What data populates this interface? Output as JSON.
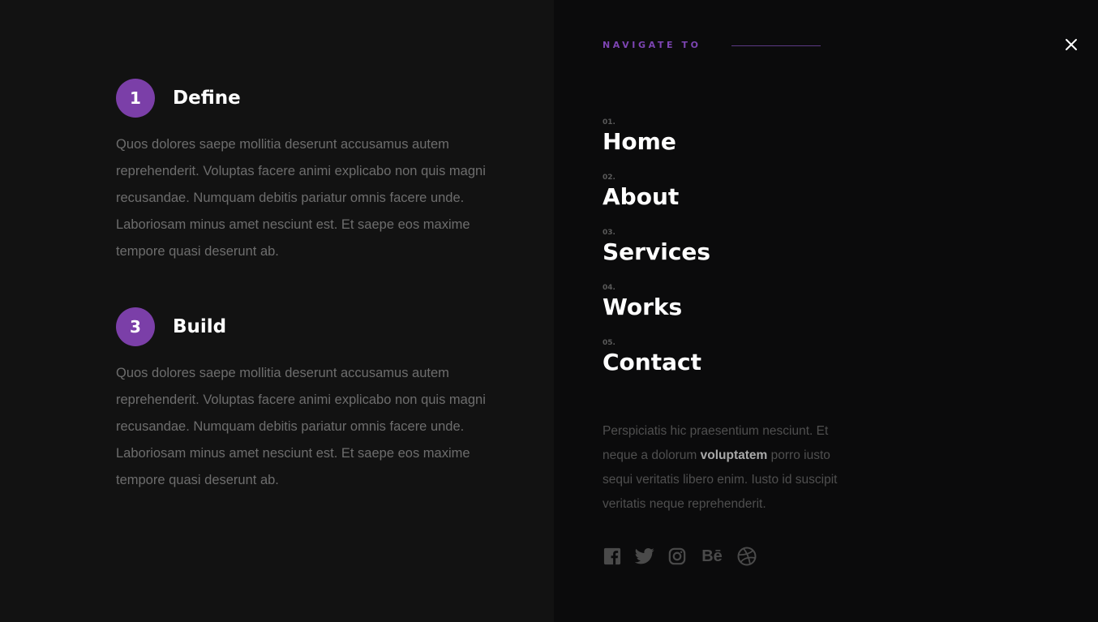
{
  "steps": [
    {
      "number": "1",
      "title": "Define",
      "text": "Quos dolores saepe mollitia deserunt accusamus autem reprehenderit. Voluptas facere animi explicabo non quis magni recusandae. Numquam debitis pariatur omnis facere unde. Laboriosam minus amet nesciunt est. Et saepe eos maxime tempore quasi deserunt ab."
    },
    {
      "number": "3",
      "title": "Build",
      "text": "Quos dolores saepe mollitia deserunt accusamus autem reprehenderit. Voluptas facere animi explicabo non quis magni recusandae. Numquam debitis pariatur omnis facere unde. Laboriosam minus amet nesciunt est. Et saepe eos maxime tempore quasi deserunt ab."
    }
  ],
  "nav": {
    "label": "NAVIGATE TO",
    "close_icon": "close-icon",
    "items": [
      {
        "num": "01.",
        "label": "Home"
      },
      {
        "num": "02.",
        "label": "About"
      },
      {
        "num": "03.",
        "label": "Services"
      },
      {
        "num": "04.",
        "label": "Works"
      },
      {
        "num": "05.",
        "label": "Contact"
      }
    ]
  },
  "blurb": {
    "before": "Perspiciatis hic praesentium nesciunt. Et neque a dolorum ",
    "strong": "voluptatem",
    "after": " porro iusto sequi veritatis libero enim. Iusto id suscipit veritatis neque reprehenderit."
  },
  "socials": {
    "facebook": "facebook-icon",
    "twitter": "twitter-icon",
    "instagram": "instagram-icon",
    "behance": "Bē",
    "dribbble": "dribbble-icon"
  },
  "colors": {
    "accent": "#7b3fa8",
    "left_bg": "#121212",
    "right_bg": "#0b0b0c"
  }
}
